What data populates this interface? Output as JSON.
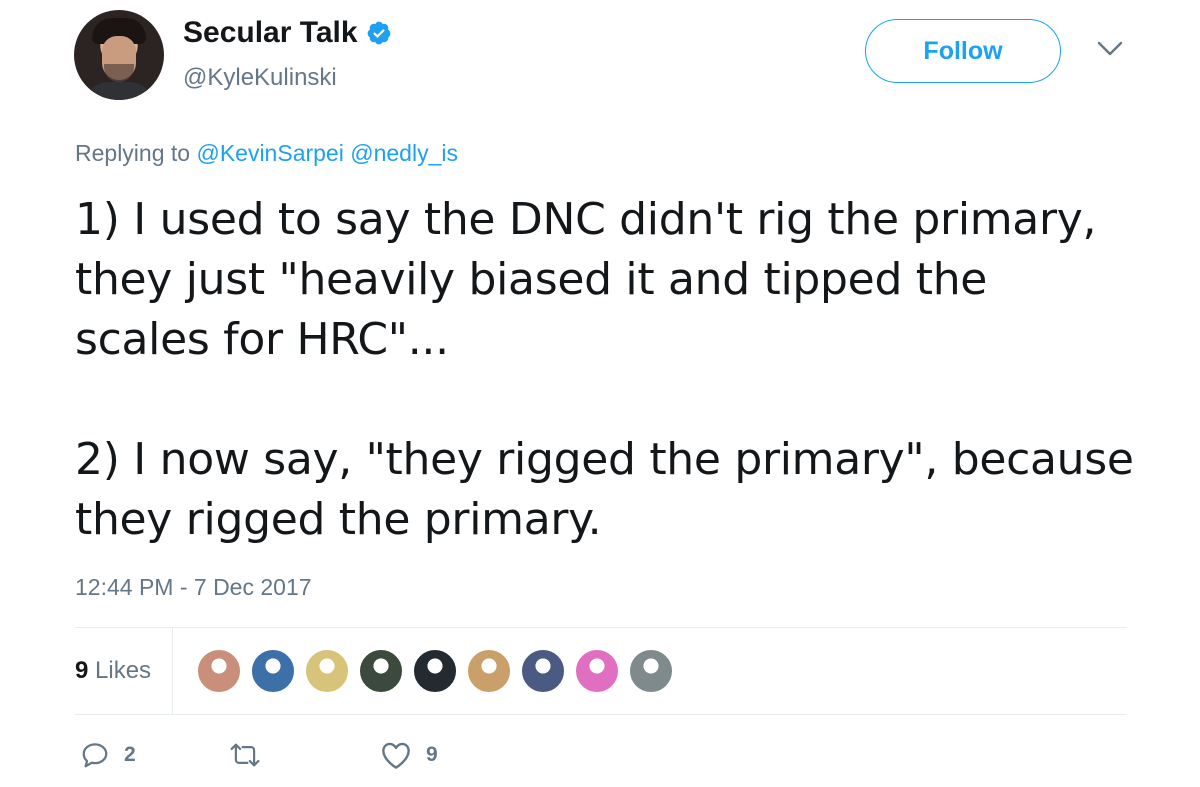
{
  "author": {
    "display_name": "Secular Talk",
    "handle": "@KyleKulinski",
    "verified": true
  },
  "follow_button": {
    "label": "Follow"
  },
  "replying": {
    "prefix": "Replying to",
    "mentions": [
      "@KevinSarpei",
      "@nedly_is"
    ]
  },
  "tweet": {
    "paragraph1": "1) I used to say the DNC didn't rig the primary, they just \"heavily biased it and tipped the scales for HRC\"...",
    "paragraph2": "2) I now say, \"they rigged the primary\", because they rigged the primary."
  },
  "timestamp": "12:44 PM - 7 Dec 2017",
  "likes": {
    "count": "9",
    "label": "Likes",
    "avatars": [
      {
        "name": "liker-1",
        "color": "#c98f7a"
      },
      {
        "name": "liker-2",
        "color": "#3d6fa8"
      },
      {
        "name": "liker-3",
        "color": "#d8c37a"
      },
      {
        "name": "liker-4",
        "color": "#3b4a3d"
      },
      {
        "name": "liker-5",
        "color": "#232a30"
      },
      {
        "name": "liker-6",
        "color": "#caa06a"
      },
      {
        "name": "liker-7",
        "color": "#4b5a82"
      },
      {
        "name": "liker-8",
        "color": "#e06fc2"
      },
      {
        "name": "liker-9",
        "color": "#7f8a8c"
      }
    ]
  },
  "actions": {
    "reply_count": "2",
    "retweet_count": "",
    "like_count": "9"
  },
  "colors": {
    "accent": "#1da1f2",
    "secondary_text": "#657786",
    "primary_text": "#14171a",
    "divider": "#e6ecf0"
  },
  "icons": [
    "verified-badge-icon",
    "chevron-down-icon",
    "reply-icon",
    "retweet-icon",
    "heart-icon"
  ]
}
